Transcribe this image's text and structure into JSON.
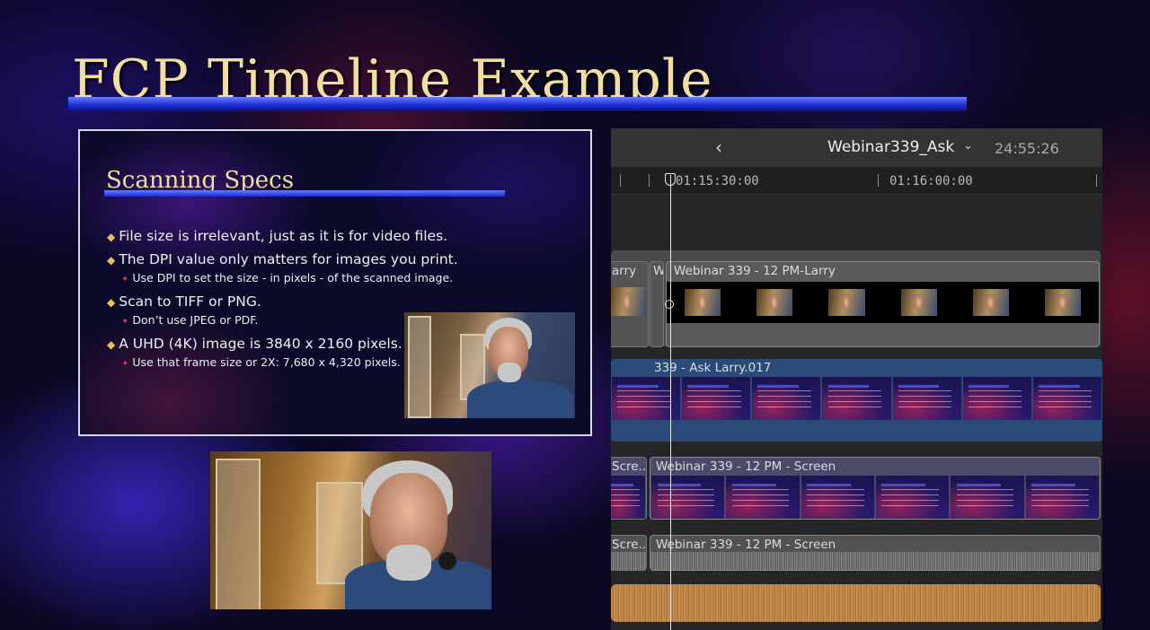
{
  "title": "FCP Timeline Example",
  "slide": {
    "title": "Scanning Specs",
    "bullets": [
      "File size is irrelevant, just as it is for video files.",
      "The DPI value only matters for images you print.",
      "Use DPI to set the size - in pixels - of the scanned image.",
      "Scan to TIFF or PNG.",
      "Don’t use JPEG or PDF.",
      "A UHD (4K) image is 3840 x 2160 pixels.",
      "Use that frame size or 2X: 7,680 x 4,320 pixels."
    ]
  },
  "timeline": {
    "back_icon": "‹",
    "project_name": "Webinar339_Ask",
    "chevron": "⌄",
    "duration": "24:55:26",
    "ruler": [
      "01:15:30:00",
      "01:16:00:00"
    ],
    "clips": {
      "larry_prev": "arry",
      "larry_gap": "W",
      "larry_main": "Webinar 339 - 12 PM-Larry",
      "ask_larry": "339 - Ask Larry.017",
      "screen_prev": "Scre...",
      "screen_main": "Webinar 339 - 12 PM - Screen",
      "audio_prev": "Scre...",
      "audio_main": "Webinar 339 - 12 PM - Screen"
    }
  }
}
